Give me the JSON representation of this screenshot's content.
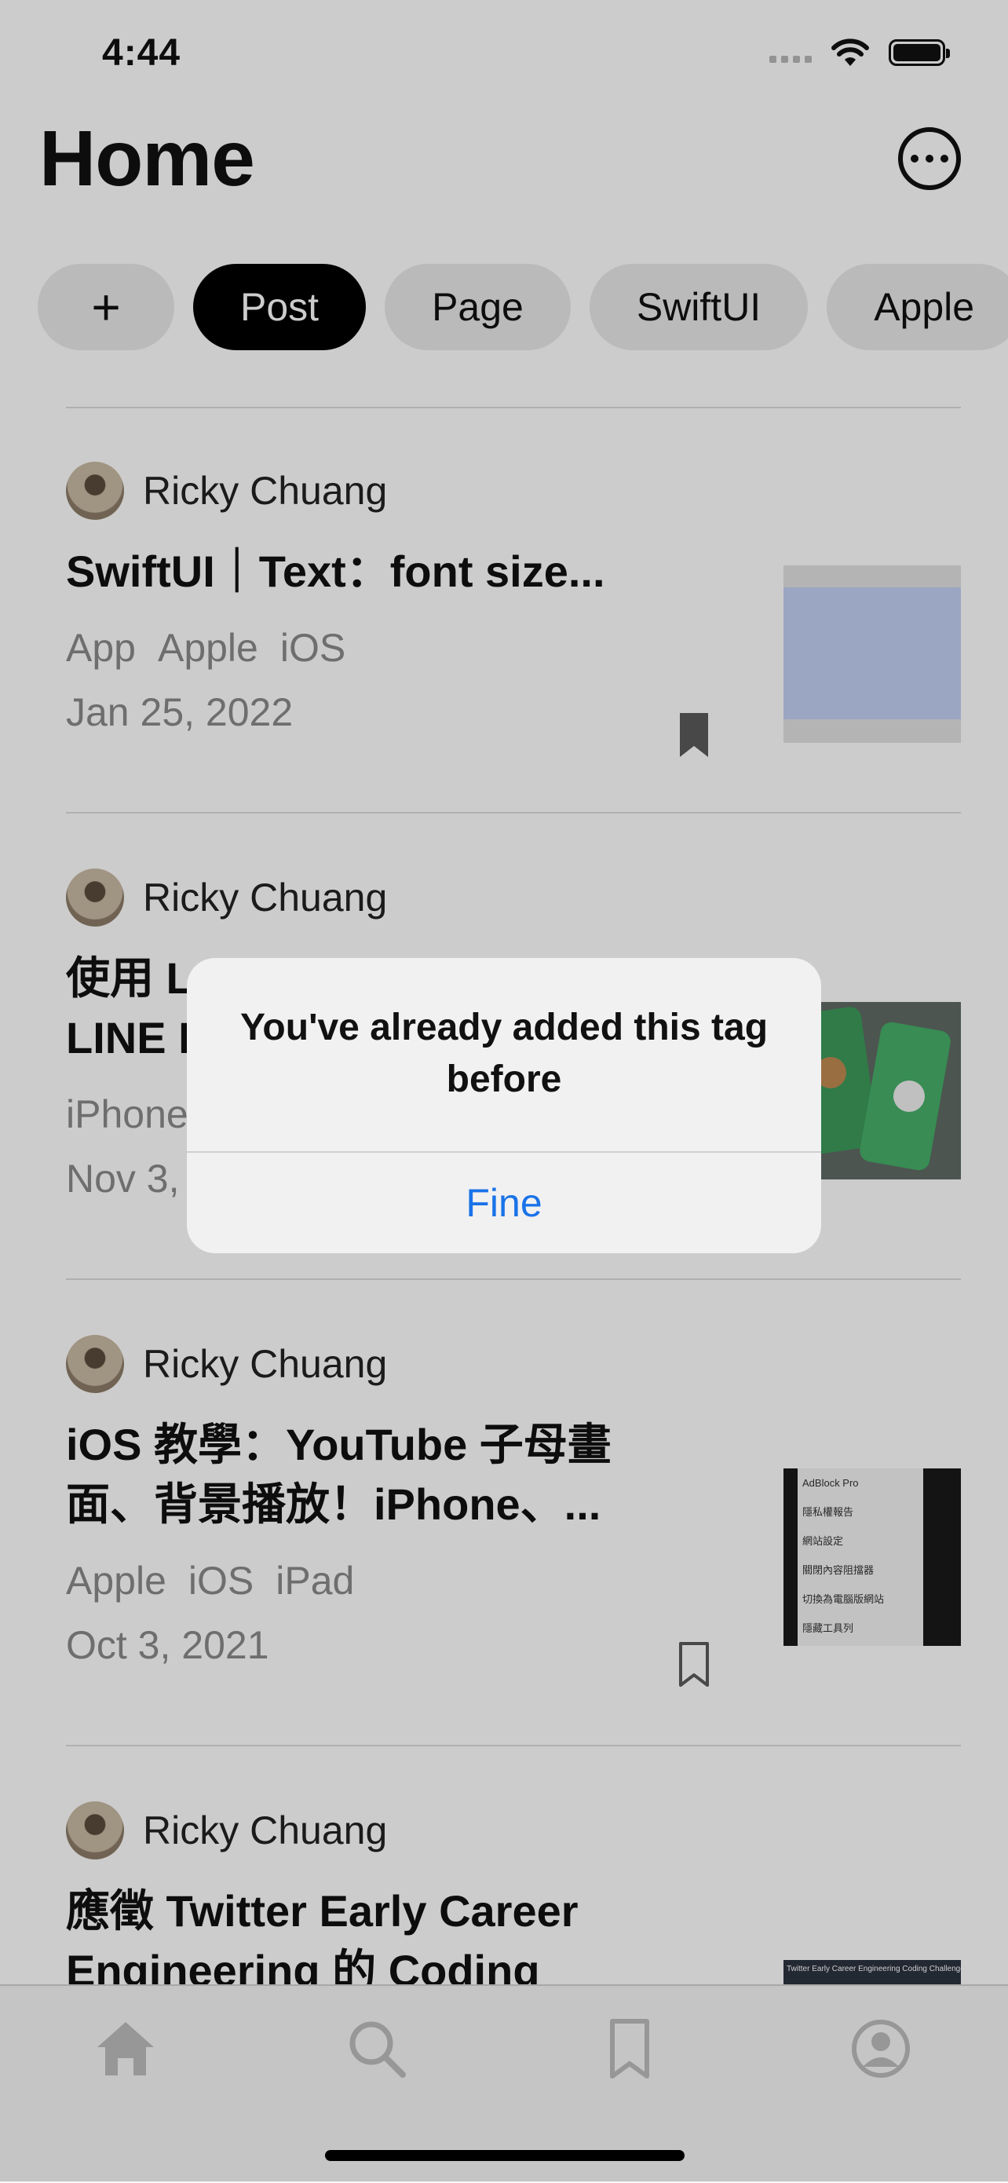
{
  "status_bar": {
    "time": "4:44"
  },
  "header": {
    "title": "Home"
  },
  "tags": {
    "add_label": "+",
    "items": [
      "Post",
      "Page",
      "SwiftUI",
      "Apple"
    ],
    "active": "Post"
  },
  "posts": [
    {
      "author": "Ricky Chuang",
      "title": "SwiftUI｜Text：font size...",
      "tags": [
        "App",
        "Apple",
        "iOS"
      ],
      "date": "Jan 25, 2022",
      "bookmarked": true
    },
    {
      "author": "Ricky Chuang",
      "title_line1_visible": "使用 L",
      "title_line2_visible": "LINE F",
      "tags_visible": "iPhone",
      "date_visible": "Nov 3,"
    },
    {
      "author": "Ricky Chuang",
      "title": "iOS 教學：YouTube 子母畫面、背景播放！iPhone、...",
      "tags": [
        "Apple",
        "iOS",
        "iPad"
      ],
      "date": "Oct 3, 2021",
      "bookmarked": false,
      "thumb_menu": [
        "AdBlock Pro",
        "隱私權報告",
        "網站設定",
        "關閉內容阻擋器",
        "切換為電腦版網站",
        "隱藏工具列"
      ]
    },
    {
      "author": "Ricky Chuang",
      "title": "應徵 Twitter Early Career Engineering 的 Coding",
      "thumb_caption": "Twitter Early Career Engineering Coding Challenge"
    }
  ],
  "alert": {
    "message": "You've already added this tag before",
    "button": "Fine"
  },
  "tab_bar": {
    "items": [
      "home-icon",
      "search-icon",
      "bookmark-icon",
      "profile-icon"
    ]
  },
  "colors": {
    "accent": "#1a73e8",
    "active_chip": "#000000",
    "chip": "#e9e9e9"
  }
}
